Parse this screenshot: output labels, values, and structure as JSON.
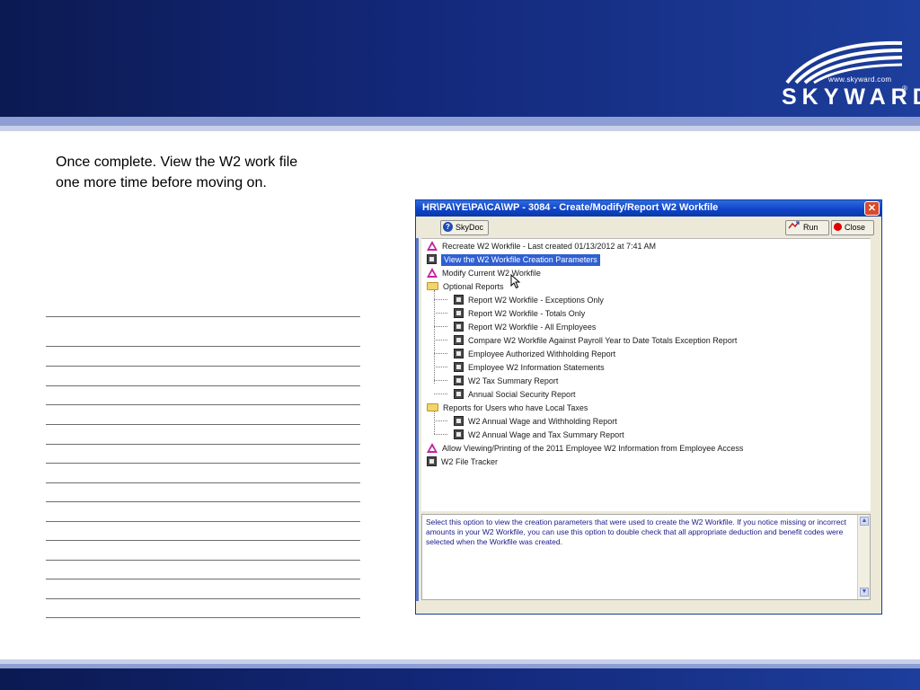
{
  "banner": {
    "logo": {
      "url": "www.skyward.com",
      "name": "SKYWARD",
      "reg": "®"
    }
  },
  "caption": {
    "line1": "Once complete.  View the W2 work file",
    "line2": "one more time before moving on."
  },
  "window": {
    "title": "HR\\PA\\YE\\PA\\CA\\WP - 3084 - Create/Modify/Report W2 Workfile",
    "close_glyph": "✕",
    "toolbar": {
      "skydoc_label": "SkyDoc",
      "run_label": "Run",
      "close_label": "Close"
    },
    "tree": {
      "recreate": "Recreate W2 Workfile - Last created 01/13/2012 at  7:41 AM",
      "view_params": "View the W2 Workfile Creation Parameters",
      "modify": "Modify Current W2 Workfile",
      "optional_reports": "Optional Reports",
      "optional_items": [
        "Report W2 Workfile - Exceptions Only",
        "Report W2 Workfile - Totals Only",
        "Report W2 Workfile - All Employees",
        "Compare W2 Workfile Against Payroll Year to Date Totals Exception Report",
        "Employee Authorized Withholding Report",
        "Employee W2 Information Statements",
        "W2 Tax Summary Report",
        "Annual Social Security Report"
      ],
      "local_taxes": "Reports for Users who have Local Taxes",
      "local_items": [
        "W2 Annual Wage and Withholding Report",
        "W2 Annual Wage and Tax Summary Report"
      ],
      "allow_viewing": "Allow Viewing/Printing of the 2011 Employee W2 Information from Employee Access",
      "file_tracker": "W2 File Tracker"
    },
    "description": "Select this option to view the creation parameters that were used to create the W2 Workfile.  If you notice missing or incorrect amounts in your W2 Workfile, you can use this option to double check that all appropriate deduction and benefit codes were selected when the Workfile was created.",
    "scroll_up": "▲",
    "scroll_down": "▼"
  }
}
